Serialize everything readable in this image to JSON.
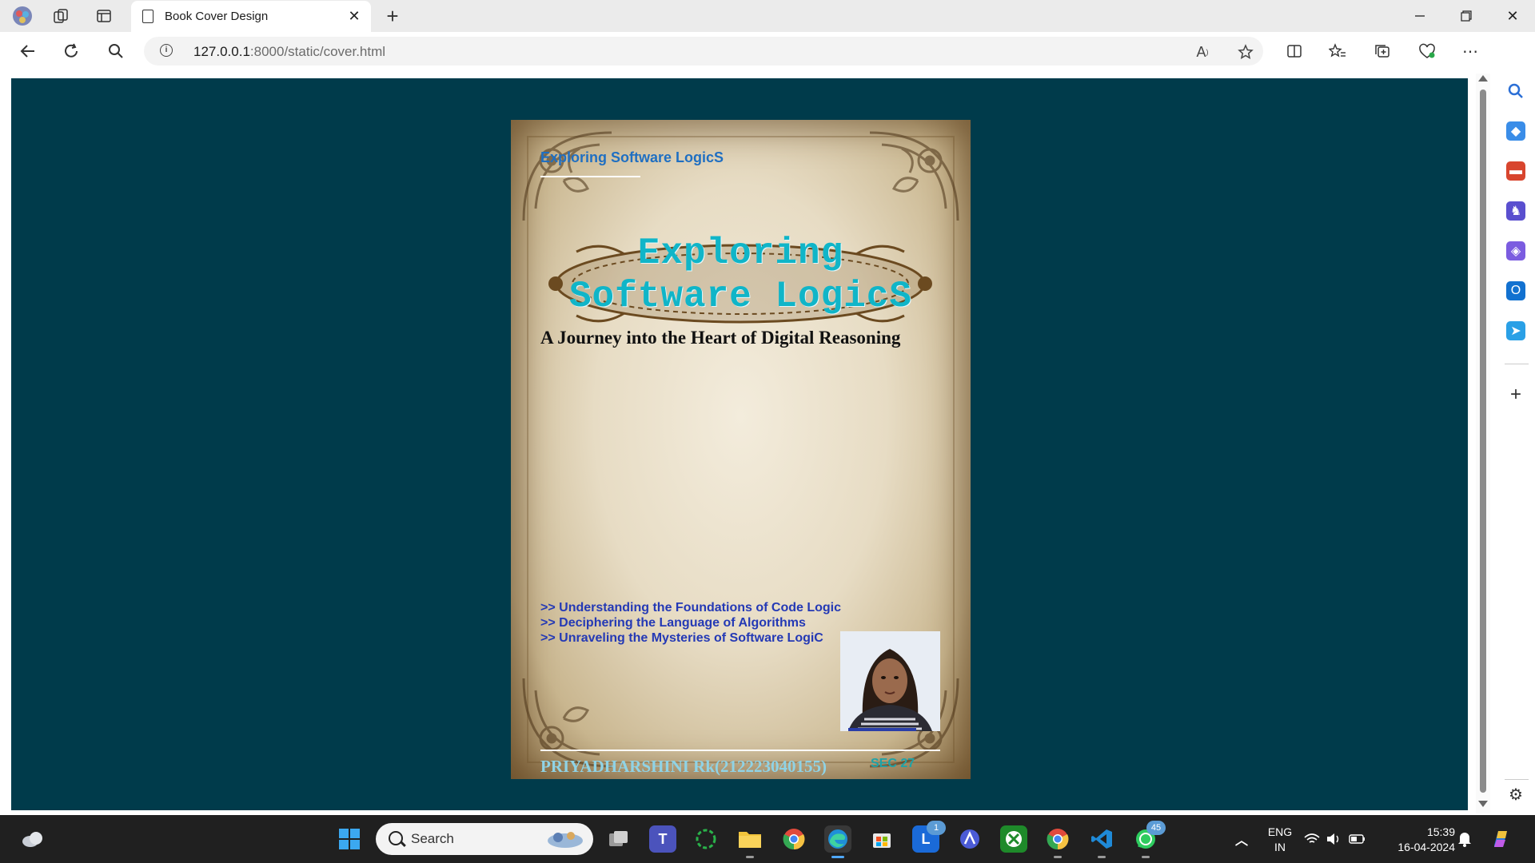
{
  "browser": {
    "tab_title": "Book Cover Design",
    "url_host": "127.0.0.1",
    "url_rest": ":8000/static/cover.html"
  },
  "cover": {
    "header_text": "Exploring Software LogicS",
    "title_line1": "Exploring",
    "title_line2": "Software LogicS",
    "subtitle": "A Journey into the Heart of Digital Reasoning",
    "bullets": [
      ">> Understanding the Foundations of Code Logic",
      ">> Deciphering the Language of Algorithms",
      ">> Unraveling the Mysteries of Software LogiC"
    ],
    "author": "PRIYADHARSHINI Rk(212223040155)",
    "section": "SEC 27"
  },
  "taskbar": {
    "search_placeholder": "Search",
    "lang_line1": "ENG",
    "lang_line2": "IN",
    "time": "15:39",
    "date": "16-04-2024",
    "badge_outlook": "1",
    "badge_whatsapp": "45"
  },
  "colors": {
    "page_bg": "#003b4b",
    "title_color": "#10b5c8",
    "bullet_color": "#2439b5",
    "author_color": "#8fd3e6"
  }
}
